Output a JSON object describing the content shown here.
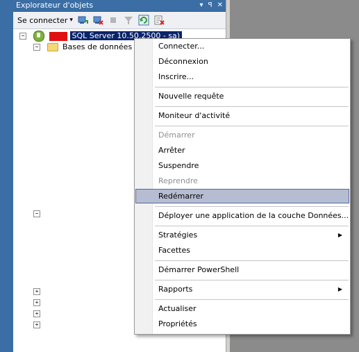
{
  "explorer": {
    "title": "Explorateur d'objets",
    "title_buttons": [
      "▾",
      "ꟼ",
      "✕"
    ],
    "toolbar": {
      "connect_label": "Se connecter",
      "connect_arrow": "▾"
    },
    "server_label": "SQL Server 10.50.2500 - sa)",
    "databases_label": "Bases de données",
    "expanders": {
      "minus": "−",
      "plus": "+"
    }
  },
  "context_menu": {
    "items": [
      {
        "label": "Connecter...",
        "disabled": false
      },
      {
        "label": "Déconnexion",
        "disabled": false
      },
      {
        "label": "Inscrire...",
        "disabled": false
      },
      {
        "label": "Nouvelle requête",
        "disabled": false
      },
      {
        "label": "Moniteur d'activité",
        "disabled": false
      },
      {
        "label": "Démarrer",
        "disabled": true
      },
      {
        "label": "Arrêter",
        "disabled": false
      },
      {
        "label": "Suspendre",
        "disabled": false
      },
      {
        "label": "Reprendre",
        "disabled": true
      },
      {
        "label": "Redémarrer",
        "disabled": false,
        "highlighted": true
      },
      {
        "label": "Déployer une application de la couche Données...",
        "disabled": false
      },
      {
        "label": "Stratégies",
        "disabled": false,
        "submenu": true
      },
      {
        "label": "Facettes",
        "disabled": false
      },
      {
        "label": "Démarrer PowerShell",
        "disabled": false
      },
      {
        "label": "Rapports",
        "disabled": false,
        "submenu": true
      },
      {
        "label": "Actualiser",
        "disabled": false
      },
      {
        "label": "Propriétés",
        "disabled": false
      }
    ],
    "submenu_arrow": "▶"
  },
  "colors": {
    "highlight": "#b6bdd2",
    "title_bar": "#3a6ea5",
    "desktop_grey": "#8b8b8b"
  }
}
